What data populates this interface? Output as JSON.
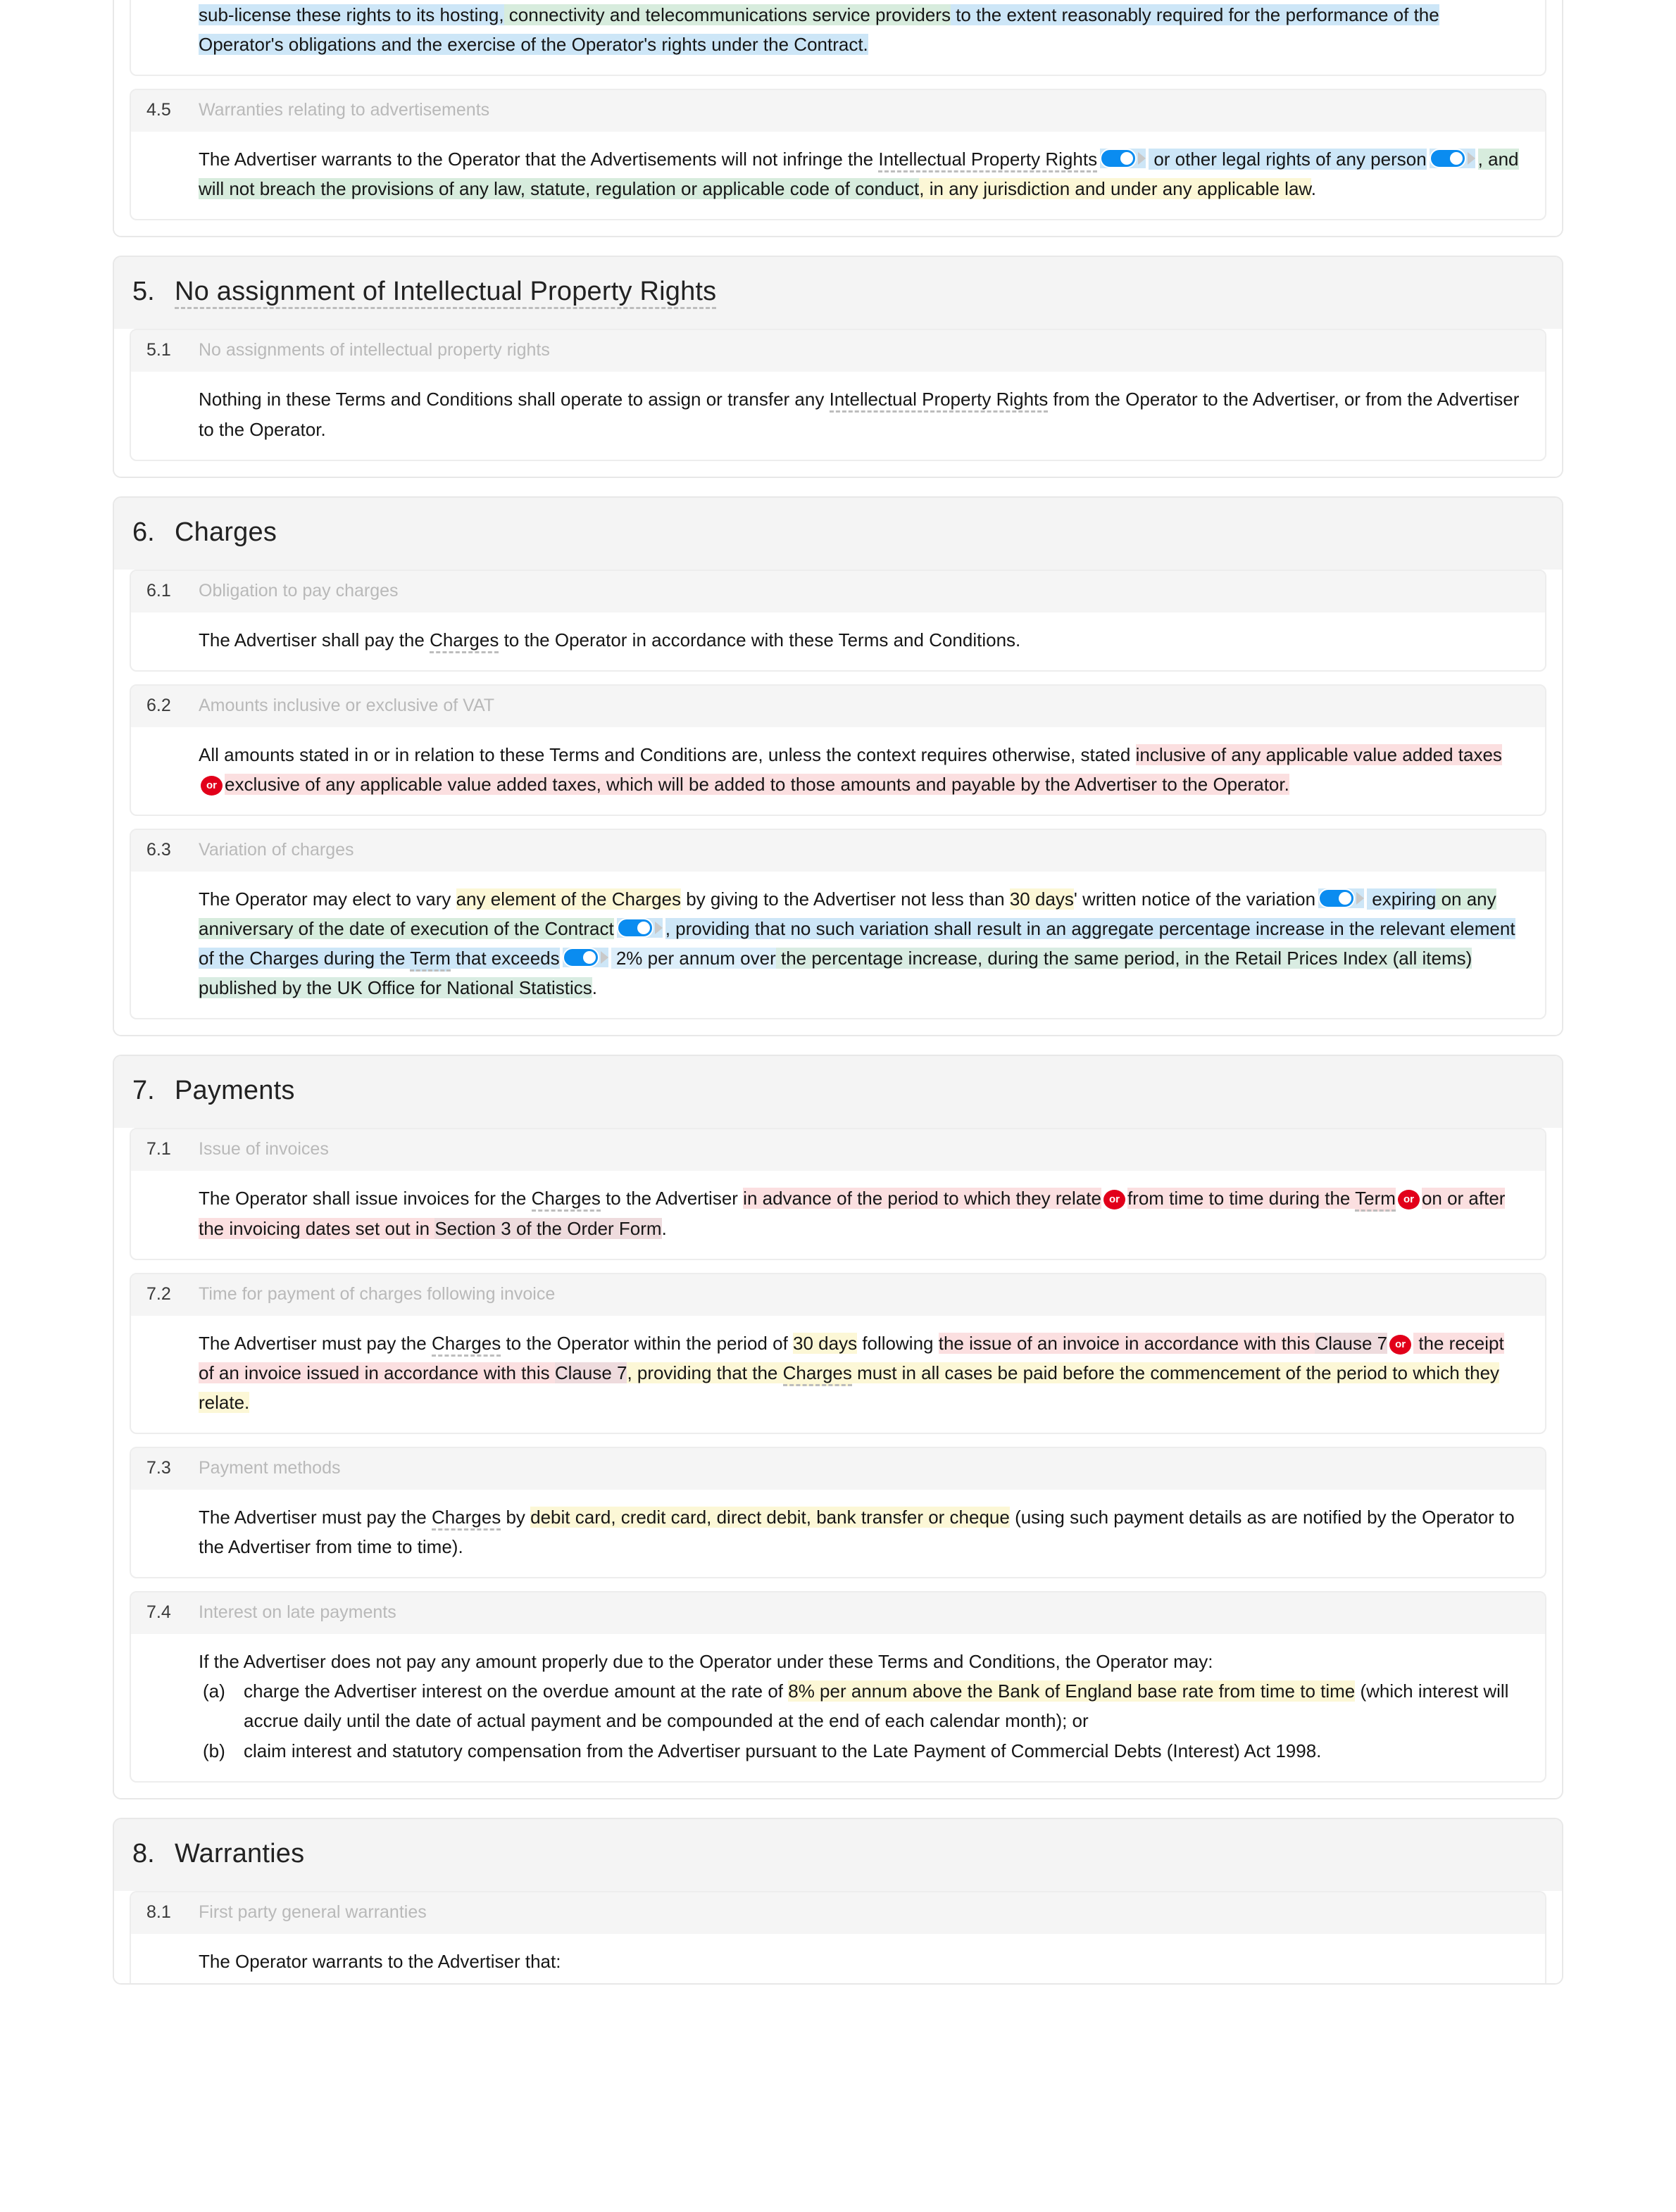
{
  "colors": {
    "accent_blue": "#0a8cf0",
    "or_badge_red": "#e2001a",
    "hl_blue": "#cde6f7",
    "hl_green": "#d7ecdd",
    "hl_yellow": "#fcf7d6",
    "hl_pink": "#fbdfe0",
    "clause_title_gray": "#b9b9b9"
  },
  "clause_4_4_continued": {
    "seg1": "sub-license these rights to its hosting,",
    "seg2": " connectivity and telecommunications service providers",
    "seg3": " to the extent reasonably required for the performance of the Operator's obligations and the exercise of the Operator's rights under the Contract."
  },
  "clause_4_5": {
    "num": "4.5",
    "title": "Warranties relating to advertisements",
    "t1": "The Advertiser warrants to the Operator that the Advertisements will not infringe the ",
    "term1": "Intellectual Property Rights",
    "t2": " or other legal rights",
    "t3": " of any person",
    "t4": ", and will not breach the provisions of any law, statute, regulation or applicable code of conduct",
    "t5": ", in any jurisdiction and under any applicable law",
    "t6": "."
  },
  "section_5": {
    "num": "5.",
    "title": "No assignment of Intellectual Property Rights",
    "clauses": [
      {
        "num": "5.1",
        "title": "No assignments of intellectual property rights",
        "t1": "Nothing in these Terms and Conditions shall operate to assign or transfer any ",
        "term1": "Intellectual Property Rights",
        "t2": " from the Operator to the Advertiser, or from the Advertiser to the Operator."
      }
    ]
  },
  "section_6": {
    "num": "6.",
    "title": "Charges",
    "clause_6_1": {
      "num": "6.1",
      "title": "Obligation to pay charges",
      "t1": "The Advertiser shall pay the ",
      "term1": "Charges",
      "t2": " to the Operator in accordance with these Terms and Conditions."
    },
    "clause_6_2": {
      "num": "6.2",
      "title": "Amounts inclusive or exclusive of VAT",
      "t1": "All amounts stated in or in relation to these Terms and Conditions are, unless the context requires otherwise, stated ",
      "opt_a": "inclusive of any applicable value added taxes",
      "or": "or",
      "opt_b": "exclusive of any applicable value added taxes, which will be added to those amounts and payable by the Advertiser to the Operator."
    },
    "clause_6_3": {
      "num": "6.3",
      "title": "Variation of charges",
      "t1": "The Operator may elect to vary ",
      "h1": "any element of the Charges",
      "t2": " by giving to the Advertiser not less than ",
      "h2": "30 days",
      "t3": "' written notice of the variation",
      "t4": " expiring",
      "t5": " on any anniversary of the date of execution of the Contract",
      "t6": ", providing that no such variation shall result in an aggregate percentage increase in the relevant element of the Charges during the ",
      "term_term": "Term",
      "t7": " that exceeds",
      "t8": " 2% per annum over",
      "t9": " the percentage increase, during the same period, in the Retail Prices Index (all items) published by the UK Office for National Statistics",
      "t10": "."
    }
  },
  "section_7": {
    "num": "7.",
    "title": "Payments",
    "clause_7_1": {
      "num": "7.1",
      "title": "Issue of invoices",
      "t1": "The Operator shall issue invoices for the ",
      "term1": "Charges",
      "t2": " to the Advertiser ",
      "opt_a": "in advance of the period to which they relate",
      "or1": "or",
      "opt_b_pre": "from time to time during the ",
      "opt_b_term": "Term",
      "or2": "or",
      "opt_c": "on or after the invoicing dates set out in ",
      "opt_c_ref": "Section 3 of the Order Form",
      "tail": "."
    },
    "clause_7_2": {
      "num": "7.2",
      "title": "Time for payment of charges following invoice",
      "t1": "The Advertiser must pay the ",
      "term1": "Charges",
      "t2": " to the Operator within the period of ",
      "h_days": "30 days",
      "t3": " following ",
      "opt_a_pre": "the issue of an invoice in accordance with this ",
      "opt_a_ref": "Clause 7",
      "or": "or",
      "opt_b_pre": " the receipt of an invoice issued in accordance with this ",
      "opt_b_ref": "Clause 7",
      "t4": ", providing that the ",
      "term2": "Charges",
      "t5": " must in all cases be paid before the commencement of the period to which they relate."
    },
    "clause_7_3": {
      "num": "7.3",
      "title": "Payment methods",
      "t1": "The Advertiser must pay the ",
      "term1": "Charges",
      "t2": " by ",
      "h1": "debit card, credit card, direct debit, bank transfer or cheque",
      "t3": " (using such payment details as are notified by the Operator to the Advertiser from time to time)."
    },
    "clause_7_4": {
      "num": "7.4",
      "title": "Interest on late payments",
      "intro": "If the Advertiser does not pay any amount properly due to the Operator under these Terms and Conditions, the Operator may:",
      "items": [
        {
          "marker": "(a)",
          "t1": "charge the Advertiser interest on the overdue amount at the rate of ",
          "h1": "8% per annum above the Bank of England base rate from time to time",
          "t2": " (which interest will accrue daily until the date of actual payment and be compounded at the end of each calendar month); or"
        },
        {
          "marker": "(b)",
          "t1": "claim interest and statutory compensation from the Advertiser pursuant to the Late Payment of Commercial Debts (Interest) Act 1998.",
          "h1": "",
          "t2": ""
        }
      ]
    }
  },
  "section_8": {
    "num": "8.",
    "title": "Warranties",
    "clause_8_1": {
      "num": "8.1",
      "title": "First party general warranties",
      "t1": "The Operator warrants to the Advertiser that:"
    }
  }
}
